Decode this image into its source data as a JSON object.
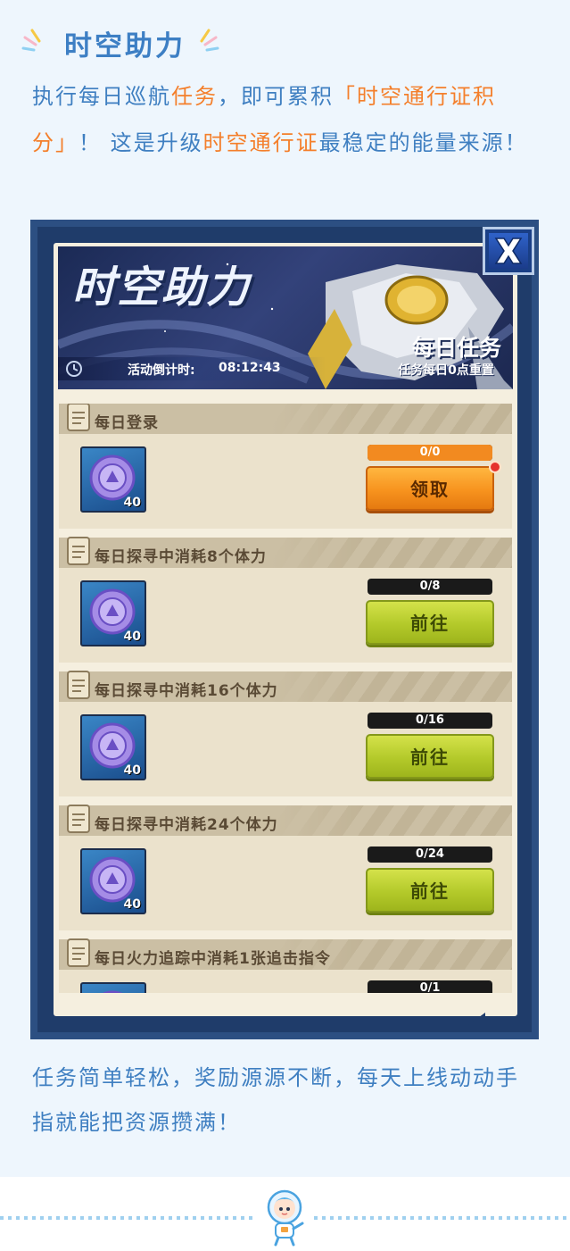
{
  "section": {
    "title": "时空助力"
  },
  "intro": {
    "seg1": "执行每日巡航",
    "seg2": "任务",
    "seg3": "，即可累积",
    "seg4": "「时空通行证积分」",
    "seg5": "！ 这是升级",
    "seg6": "时空通行证",
    "seg7": "最稳定的能量来源！"
  },
  "game": {
    "banner_title": "时空助力",
    "timer_label": "活动倒计时:",
    "timer_value": "08:12:43",
    "daily_title": "每日任务",
    "daily_subtitle": "任务每日0点重置",
    "close_icon": "x-close-icon",
    "tasks": [
      {
        "title": "每日登录",
        "reward_count": "40",
        "progress_text": "0/0",
        "progress_fraction": 1.0,
        "button": "领取",
        "button_type": "claim",
        "has_notice": true
      },
      {
        "title": "每日探寻中消耗8个体力",
        "reward_count": "40",
        "progress_text": "0/8",
        "progress_fraction": 0,
        "button": "前往",
        "button_type": "go",
        "has_notice": false
      },
      {
        "title": "每日探寻中消耗16个体力",
        "reward_count": "40",
        "progress_text": "0/16",
        "progress_fraction": 0,
        "button": "前往",
        "button_type": "go",
        "has_notice": false
      },
      {
        "title": "每日探寻中消耗24个体力",
        "reward_count": "40",
        "progress_text": "0/24",
        "progress_fraction": 0,
        "button": "前往",
        "button_type": "go",
        "has_notice": false
      },
      {
        "title": "每日火力追踪中消耗1张追击指令",
        "reward_count": "",
        "progress_text": "0/1",
        "progress_fraction": 0,
        "button": "",
        "button_type": "go",
        "has_notice": false
      }
    ]
  },
  "outro": {
    "text": "任务简单轻松，奖励源源不断，每天上线动动手指就能把资源攒满！"
  },
  "colors": {
    "text_blue": "#3f7fc1",
    "highlight_orange": "#f47f2b",
    "frame_navy": "#1f3c6a",
    "paper": "#f5efdf",
    "claim_orange": "#f7931e",
    "go_green": "#b3c92a"
  }
}
